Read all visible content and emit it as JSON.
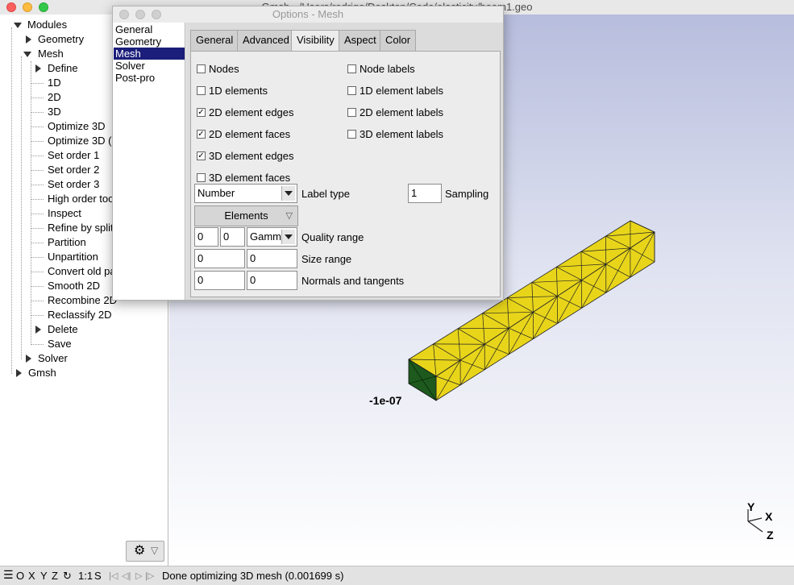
{
  "main_window": {
    "title": "Gmsh - /Users/rodrigo/Desktop/Code/elasticity/beam1.geo"
  },
  "tree": {
    "items": [
      {
        "label": "Modules"
      },
      {
        "label": "Geometry"
      },
      {
        "label": "Mesh"
      },
      {
        "label": "Define"
      },
      {
        "label": "1D"
      },
      {
        "label": "2D"
      },
      {
        "label": "3D"
      },
      {
        "label": "Optimize 3D"
      },
      {
        "label": "Optimize 3D ("
      },
      {
        "label": "Set order 1"
      },
      {
        "label": "Set order 2"
      },
      {
        "label": "Set order 3"
      },
      {
        "label": "High order too"
      },
      {
        "label": "Inspect"
      },
      {
        "label": "Refine by split"
      },
      {
        "label": "Partition"
      },
      {
        "label": "Unpartition"
      },
      {
        "label": "Convert old pa"
      },
      {
        "label": "Smooth 2D"
      },
      {
        "label": "Recombine 2D"
      },
      {
        "label": "Reclassify 2D"
      },
      {
        "label": "Delete"
      },
      {
        "label": "Save"
      },
      {
        "label": "Solver"
      },
      {
        "label": "Gmsh"
      }
    ]
  },
  "options_dialog": {
    "title": "Options - Mesh",
    "categories": [
      "General",
      "Geometry",
      "Mesh",
      "Solver",
      "Post-pro"
    ],
    "selected_category": "Mesh",
    "tabs": [
      "General",
      "Advanced",
      "Visibility",
      "Aspect",
      "Color"
    ],
    "active_tab": "Visibility",
    "checkboxes_left": [
      {
        "label": "Nodes",
        "checked": false
      },
      {
        "label": "1D elements",
        "checked": false
      },
      {
        "label": "2D element edges",
        "checked": true
      },
      {
        "label": "2D element faces",
        "checked": true
      },
      {
        "label": "3D element edges",
        "checked": true
      },
      {
        "label": "3D element faces",
        "checked": false
      }
    ],
    "checkboxes_right": [
      {
        "label": "Node labels",
        "checked": false
      },
      {
        "label": "1D element labels",
        "checked": false
      },
      {
        "label": "2D element labels",
        "checked": false
      },
      {
        "label": "3D element labels",
        "checked": false
      }
    ],
    "label_type": {
      "value": "Number",
      "label": "Label type"
    },
    "sampling": {
      "value": "1",
      "label": "Sampling"
    },
    "elements_button": "Elements",
    "quality_range": {
      "min": "0",
      "max": "0",
      "measure": "Gamm",
      "label": "Quality range"
    },
    "size_range": {
      "min": "0",
      "max": "0",
      "label": "Size range"
    },
    "normals_tangents": {
      "normals": "0",
      "tangents": "0",
      "label": "Normals and tangents"
    },
    "check_mark": "✓"
  },
  "graphics": {
    "axis_value_label": "-1e-07",
    "axes": {
      "x": "X",
      "y": "Y",
      "z": "Z"
    },
    "mesh_color": "#e8d51a",
    "end_face_color": "#1e5a1e"
  },
  "status_bar": {
    "nav_labels": [
      "O",
      "X",
      "Y",
      "Z"
    ],
    "scale": "1:1",
    "s_label": "S",
    "message": "Done optimizing 3D mesh (0.001699 s)"
  }
}
